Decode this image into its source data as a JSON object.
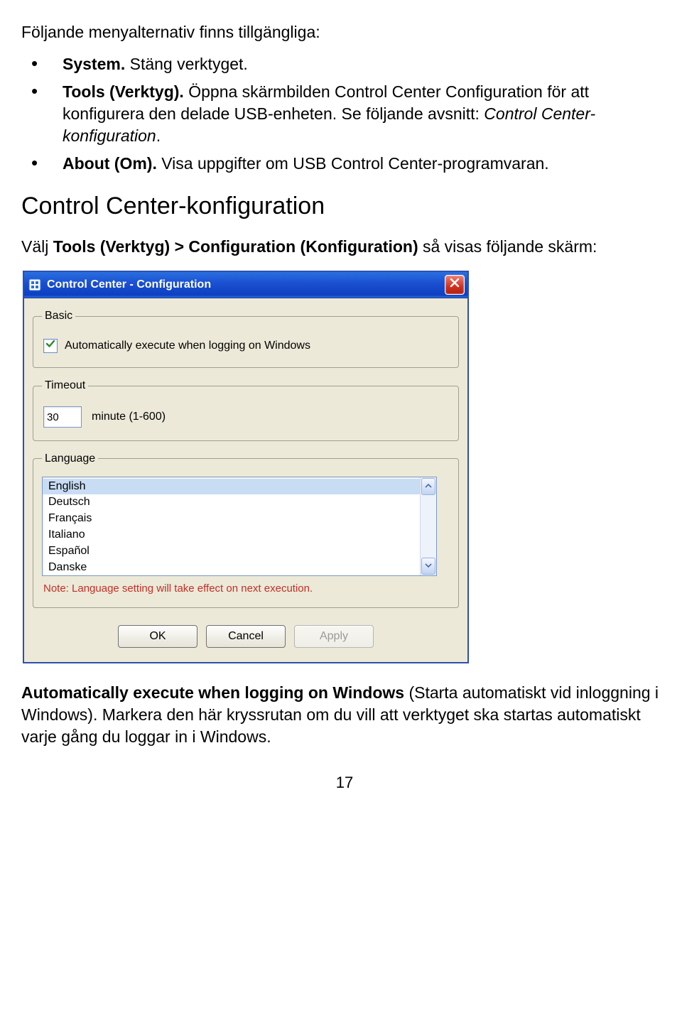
{
  "intro": "Följande menyalternativ finns tillgängliga:",
  "bullets": [
    {
      "bold": "System.",
      "plain": " Stäng verktyget."
    },
    {
      "bold": "Tools (Verktyg).",
      "plain_before": " Öppna skärmbilden Control Center Configuration för att konfigurera den delade USB-enheten. Se följande avsnitt: ",
      "italic": "Control Center-konfiguration",
      "plain_after": "."
    },
    {
      "bold": "About (Om).",
      "plain": " Visa uppgifter om USB Control Center-programvaran."
    }
  ],
  "section_heading": "Control Center-konfiguration",
  "para_before_bold": "Välj ",
  "para_bold": "Tools (Verktyg) > Configuration (Konfiguration)",
  "para_after_bold": " så visas följande skärm:",
  "dialog": {
    "title": "Control Center - Configuration",
    "groups": {
      "basic": {
        "legend": "Basic",
        "checkbox_label": "Automatically execute when logging on Windows",
        "checked": true
      },
      "timeout": {
        "legend": "Timeout",
        "value": "30",
        "suffix": "minute (1-600)"
      },
      "language": {
        "legend": "Language",
        "items": [
          "English",
          "Deutsch",
          "Français",
          "Italiano",
          "Español",
          "Danske"
        ],
        "selected_index": 0,
        "note": "Note: Language setting will take effect on next execution."
      }
    },
    "buttons": {
      "ok": "OK",
      "cancel": "Cancel",
      "apply": "Apply"
    }
  },
  "after_bold": "Automatically execute when logging on Windows",
  "after_plain": " (Starta automatiskt vid inloggning i Windows). Markera den här kryssrutan om du vill att verktyget ska startas automatiskt varje gång du loggar in i Windows.",
  "page_number": "17"
}
